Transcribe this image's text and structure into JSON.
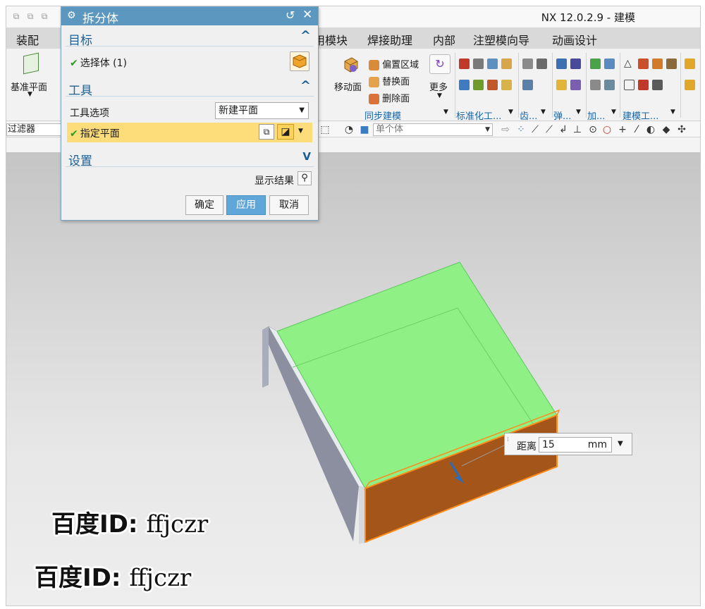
{
  "app": {
    "title": "NX 12.0.2.9 - 建模"
  },
  "menubar": {
    "items": [
      "装配",
      "用模块",
      "焊接助理",
      "内部",
      "注塑模向导",
      "动画设计"
    ]
  },
  "ribbon": {
    "datum_plane": "基准平面",
    "move_face": "移动面",
    "offset_region": "偏置区域",
    "replace_face": "替换面",
    "delete_face": "删除面",
    "more": "更多",
    "groups": {
      "sync_modeling": "同步建模",
      "standard_parts": "标准化工...",
      "gear": "齿...",
      "spring": "弹...",
      "machining": "加...",
      "modeling_tools": "建模工..."
    }
  },
  "selection_bar": {
    "filter": "过滤器",
    "scope": "单个体"
  },
  "dialog": {
    "title": "拆分体",
    "target_section": "目标",
    "select_body": "选择体 (1)",
    "tool_section": "工具",
    "tool_option_label": "工具选项",
    "tool_option_value": "新建平面",
    "specify_plane": "指定平面",
    "settings_section": "设置",
    "show_result": "显示结果",
    "ok": "确定",
    "apply": "应用",
    "cancel": "取消"
  },
  "distance_box": {
    "label": "距离",
    "value": "15",
    "unit": "mm"
  },
  "watermark": {
    "line1_cn": "百度ID:",
    "line1_id": "ffjczr",
    "line2_cn": "百度ID:",
    "line2_id": "ffjczr"
  },
  "colors": {
    "dialog_header": "#5c97bf",
    "section_title": "#1c5f93",
    "highlight_row": "#fddd7a",
    "apply_button": "#60a6d8",
    "top_face": "#8ff086",
    "cut_face": "#a3551a",
    "cut_outline": "#ff8c1a"
  }
}
